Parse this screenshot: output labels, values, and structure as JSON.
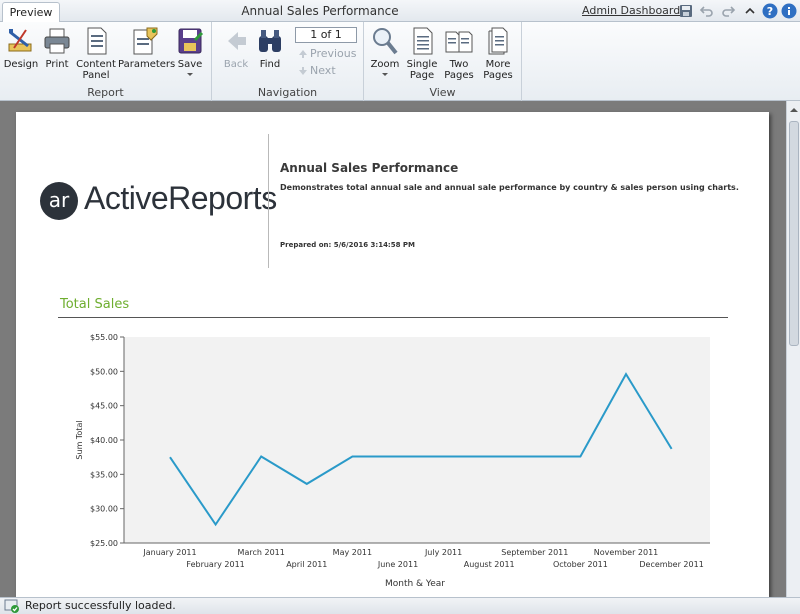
{
  "window": {
    "tab_label": "Preview",
    "title": "Annual Sales Performance",
    "admin_link": "Admin Dashboard"
  },
  "ribbon": {
    "report_group": {
      "label": "Report",
      "buttons": [
        "Design",
        "Print",
        "Content Panel",
        "Parameters",
        "Save"
      ]
    },
    "navigation_group": {
      "label": "Navigation",
      "back": "Back",
      "find": "Find",
      "page_indicator": "1 of 1",
      "previous": "Previous",
      "next": "Next"
    },
    "view_group": {
      "label": "View",
      "zoom": "Zoom",
      "single_page": "Single Page",
      "two_pages": "Two Pages",
      "more_pages": "More Pages"
    }
  },
  "report": {
    "logo_badge": "ar",
    "logo_text": "ActiveReports",
    "title": "Annual Sales Performance",
    "description": "Demonstrates total annual sale and annual sale performance  by country & sales person using charts.",
    "prepared_label": "Prepared on:",
    "prepared_value": "5/6/2016 3:14:58 PM",
    "section_title": "Total Sales"
  },
  "chart_data": {
    "type": "line",
    "categories": [
      "January 2011",
      "February 2011",
      "March 2011",
      "April 2011",
      "May 2011",
      "June 2011",
      "July 2011",
      "August 2011",
      "September 2011",
      "October 2011",
      "November 2011",
      "December 2011"
    ],
    "values": [
      37.5,
      27.7,
      37.6,
      33.6,
      37.6,
      37.6,
      37.6,
      37.6,
      37.6,
      37.6,
      49.6,
      38.7
    ],
    "y_ticks": [
      "$25.00",
      "$30.00",
      "$35.00",
      "$40.00",
      "$45.00",
      "$50.00",
      "$55.00"
    ],
    "ylim": [
      25,
      55
    ],
    "xlabel": "Month & Year",
    "ylabel": "Sum Total",
    "line_color": "#2a9ac9",
    "plot_background": "#f2f2f2"
  },
  "status": {
    "text": "Report successfully loaded."
  }
}
